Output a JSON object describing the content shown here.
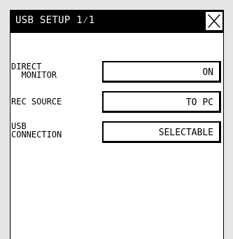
{
  "window": {
    "title": "USB SETUP 1⁄1",
    "close_icon": "close-x-icon"
  },
  "settings": [
    {
      "label_lines": [
        "DIRECT",
        "  MONITOR"
      ],
      "value": "ON"
    },
    {
      "label_lines": [
        "REC SOURCE"
      ],
      "value": "TO PC"
    },
    {
      "label_lines": [
        "USB",
        "CONNECTION"
      ],
      "value": "SELECTABLE"
    }
  ],
  "colors": {
    "title_background": "#000000",
    "title_text": "#ffffff",
    "screen_background": "#ffffff",
    "outer_background": "#e6e6e6"
  }
}
